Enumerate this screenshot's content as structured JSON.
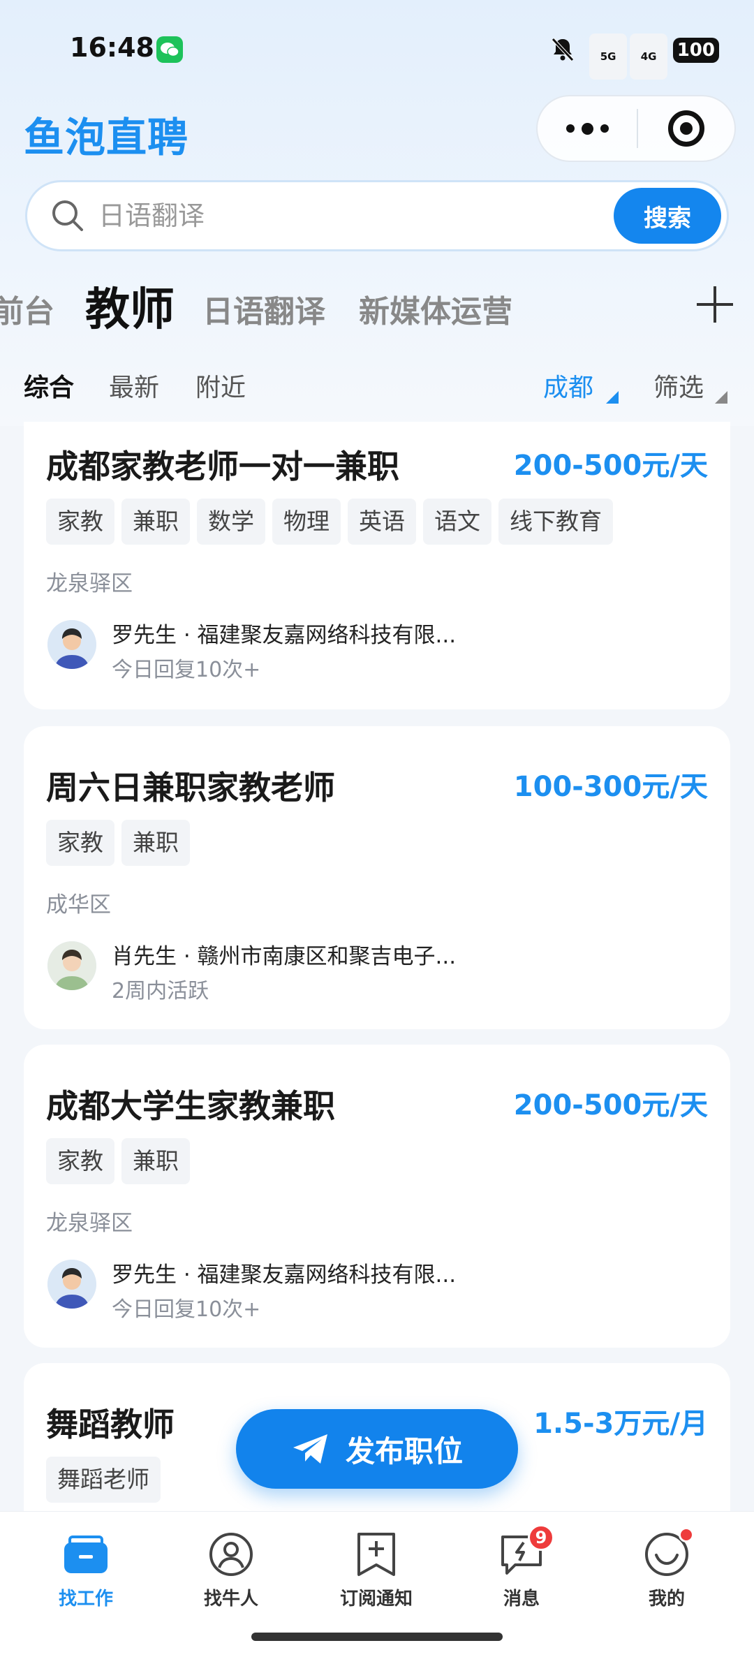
{
  "status_bar": {
    "time": "16:48",
    "network_1": "5G",
    "network_2": "4G",
    "battery": "100"
  },
  "header": {
    "app_title": "鱼泡直聘"
  },
  "search": {
    "placeholder": "日语翻译",
    "button_label": "搜索"
  },
  "category_tabs": [
    {
      "label": "前台",
      "active": false
    },
    {
      "label": "教师",
      "active": true
    },
    {
      "label": "日语翻译",
      "active": false
    },
    {
      "label": "新媒体运营",
      "active": false
    }
  ],
  "filters": {
    "sort_options": [
      "综合",
      "最新",
      "附近"
    ],
    "active_sort": "综合",
    "city": "成都",
    "filter_label": "筛选"
  },
  "jobs": [
    {
      "title": "成都家教老师一对一兼职",
      "salary": "200-500元/天",
      "tags": [
        "家教",
        "兼职",
        "数学",
        "物理",
        "英语",
        "语文",
        "线下教育"
      ],
      "district": "龙泉驿区",
      "recruiter": "罗先生 · 福建聚友嘉网络科技有限...",
      "activity": "今日回复10次+"
    },
    {
      "title": "周六日兼职家教老师",
      "salary": "100-300元/天",
      "tags": [
        "家教",
        "兼职"
      ],
      "district": "成华区",
      "recruiter": "肖先生 · 赣州市南康区和聚吉电子...",
      "activity": "2周内活跃"
    },
    {
      "title": "成都大学生家教兼职",
      "salary": "200-500元/天",
      "tags": [
        "家教",
        "兼职"
      ],
      "district": "龙泉驿区",
      "recruiter": "罗先生 · 福建聚友嘉网络科技有限...",
      "activity": "今日回复10次+"
    },
    {
      "title": "舞蹈教师",
      "salary": "1.5-3万元/月",
      "tags": [
        "舞蹈老师"
      ]
    }
  ],
  "publish_button": {
    "label": "发布职位"
  },
  "bottom_nav": [
    {
      "label": "找工作",
      "icon": "briefcase-icon",
      "active": true
    },
    {
      "label": "找牛人",
      "icon": "person-icon",
      "active": false
    },
    {
      "label": "订阅通知",
      "icon": "bookmark-plus-icon",
      "active": false
    },
    {
      "label": "消息",
      "icon": "message-icon",
      "active": false,
      "badge": "9"
    },
    {
      "label": "我的",
      "icon": "smiley-icon",
      "active": false,
      "dot": true
    }
  ],
  "colors": {
    "accent": "#1c8ff0",
    "button_blue": "#1486ee",
    "badge_red": "#ee3b3b"
  }
}
